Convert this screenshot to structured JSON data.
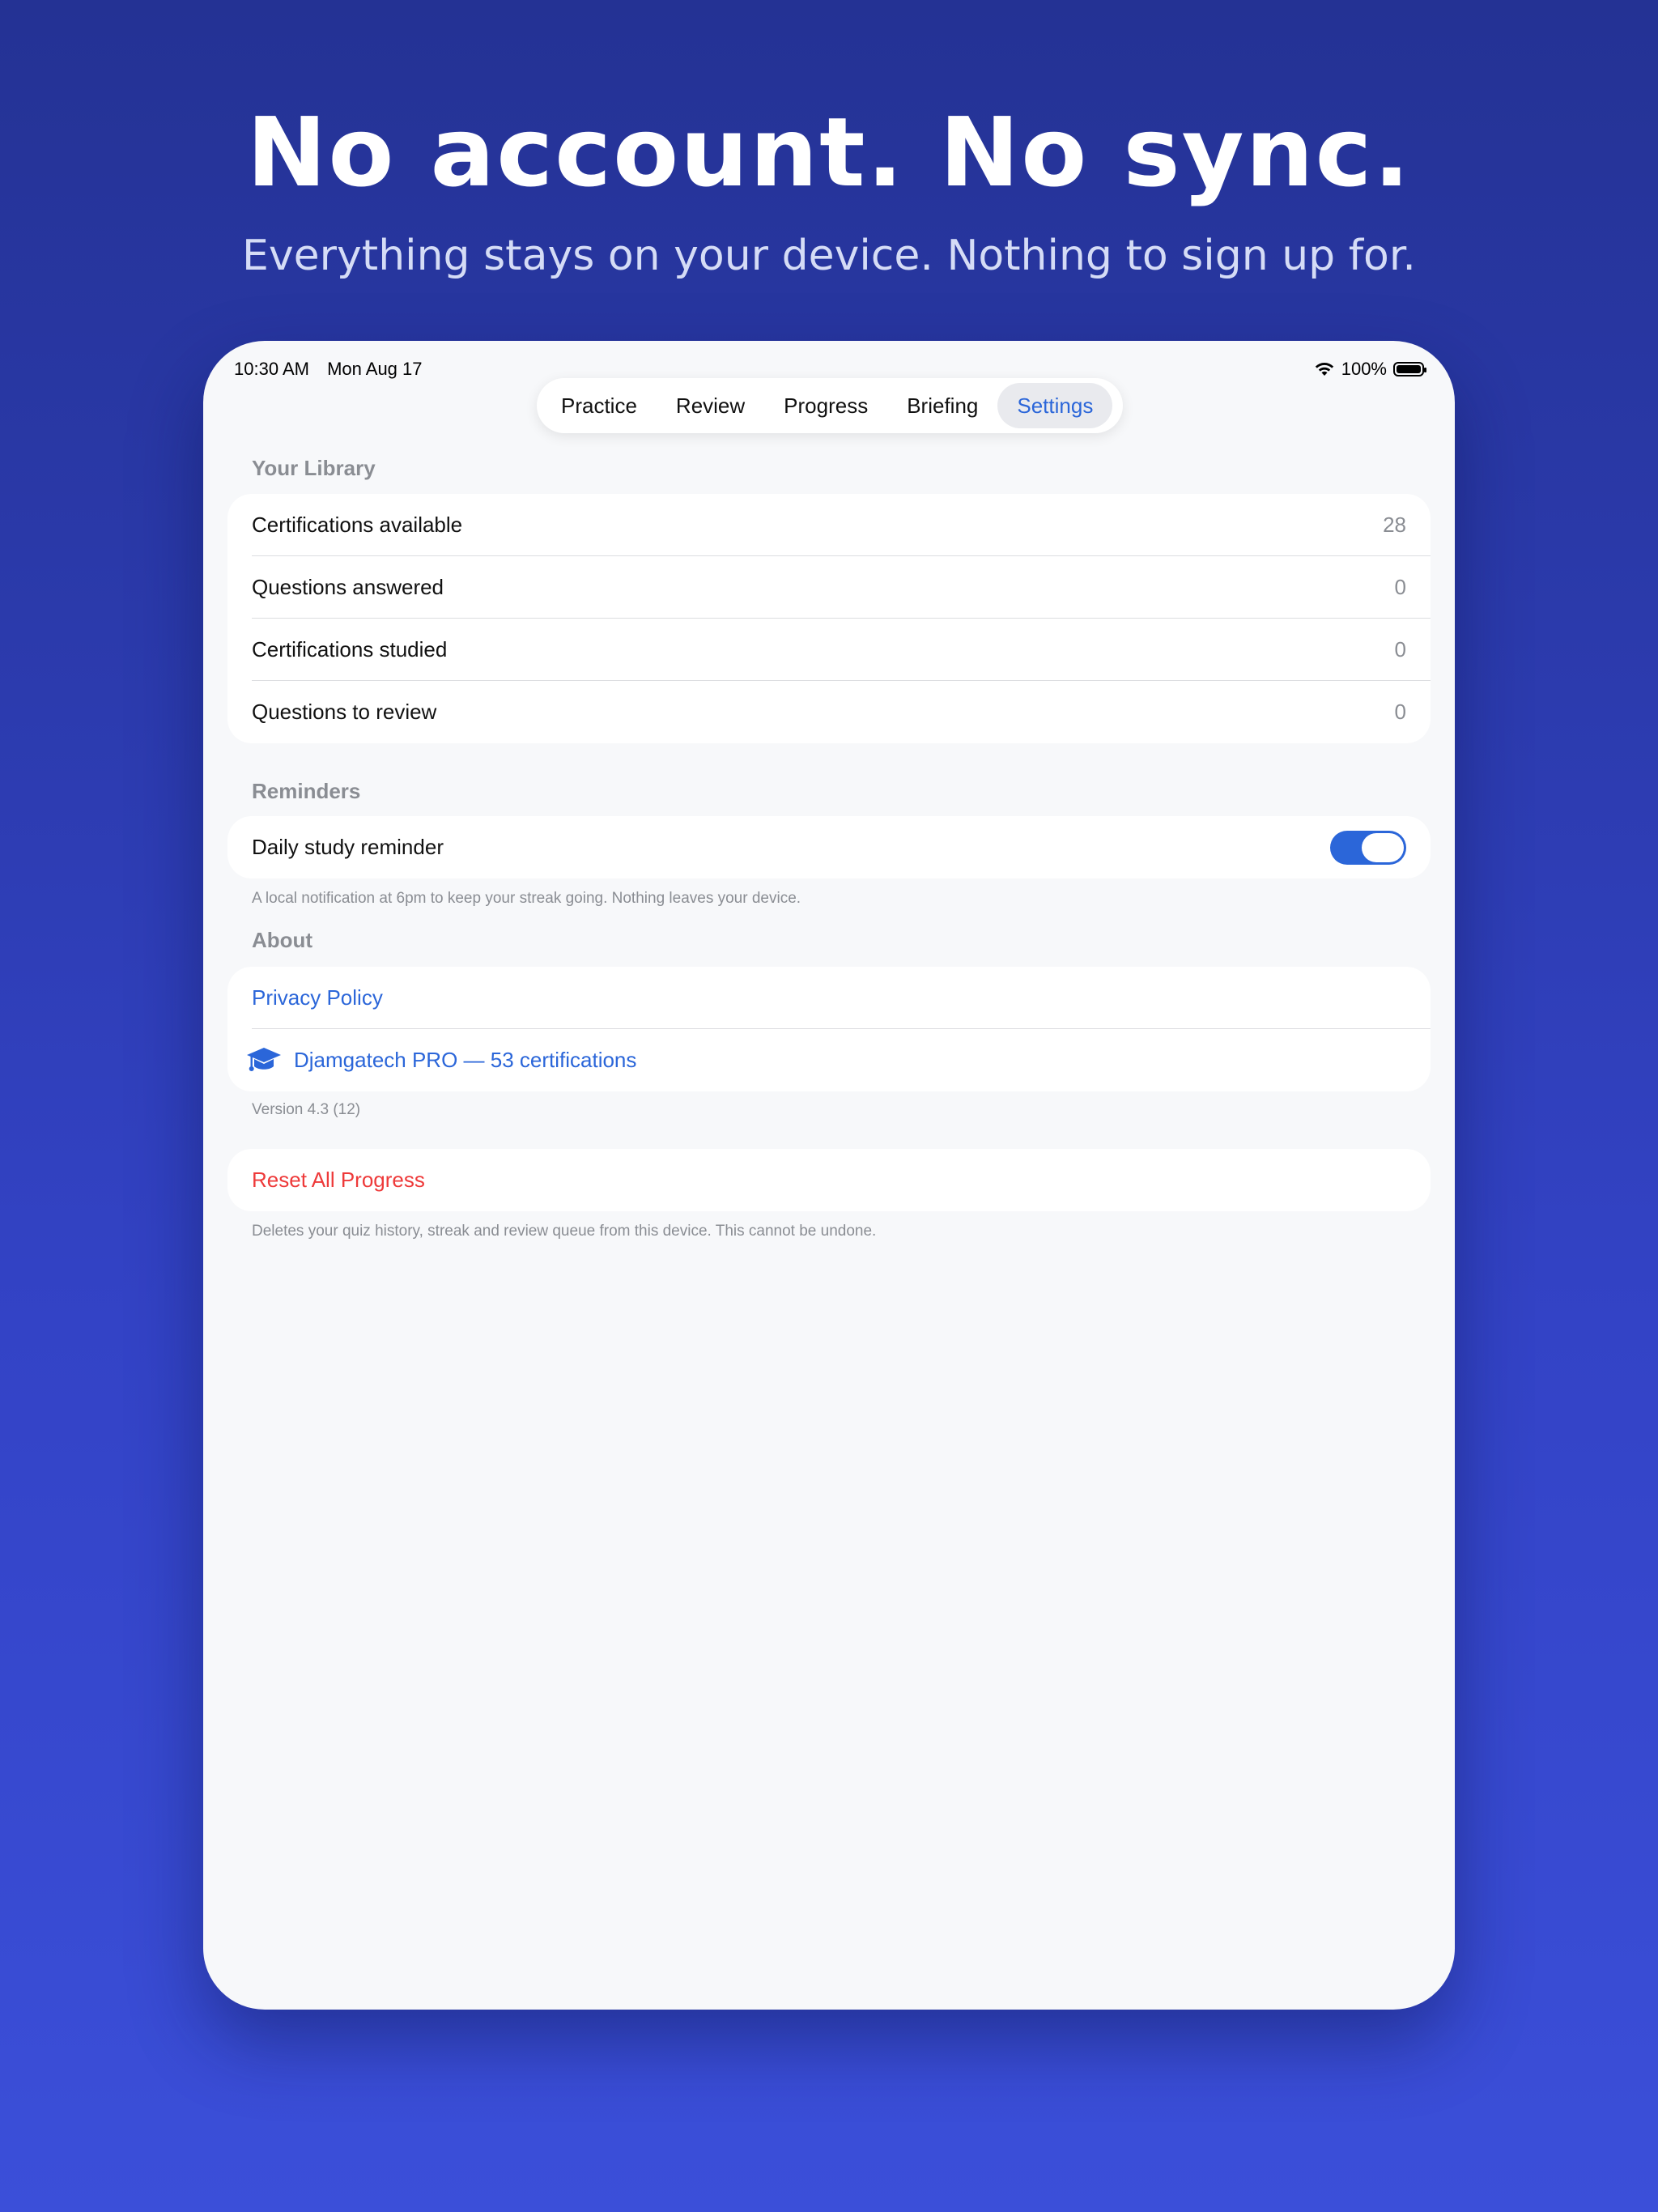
{
  "headline": "No account. No sync.",
  "subheadline": "Everything stays on your device. Nothing to sign up for.",
  "status_bar": {
    "time": "10:30 AM",
    "date": "Mon Aug 17",
    "battery": "100%",
    "battery_level": 1.0
  },
  "tabs": [
    "Practice",
    "Review",
    "Progress",
    "Briefing",
    "Settings"
  ],
  "active_tab": "Settings",
  "library": {
    "header": "Your Library",
    "rows": [
      {
        "label": "Certifications available",
        "value": "28"
      },
      {
        "label": "Questions answered",
        "value": "0"
      },
      {
        "label": "Certifications studied",
        "value": "0"
      },
      {
        "label": "Questions to review",
        "value": "0"
      }
    ]
  },
  "reminders": {
    "header": "Reminders",
    "label": "Daily study reminder",
    "enabled": true,
    "footnote": "A local notification at 6pm to keep your streak going. Nothing leaves your device."
  },
  "about": {
    "header": "About",
    "privacy_label": "Privacy Policy",
    "pro_label": "Djamgatech PRO — 53 certifications",
    "pro_icon": "graduation-cap-icon",
    "version": "Version 4.3 (12)"
  },
  "reset": {
    "label": "Reset All Progress",
    "footnote": "Deletes your quiz history, streak and review queue from this device. This cannot be undone."
  },
  "colors": {
    "accent": "#2b66d9",
    "danger": "#ee3a3a",
    "background_top": "#243294",
    "background_bottom": "#3b4fd9"
  }
}
